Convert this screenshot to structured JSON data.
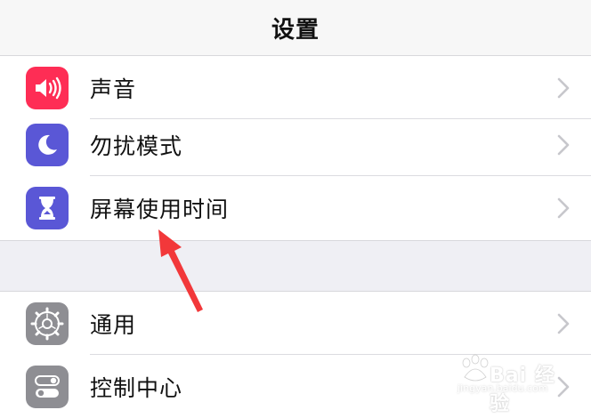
{
  "nav": {
    "title": "设置"
  },
  "group1": {
    "items": [
      {
        "label": "声音",
        "icon": "speaker-icon",
        "color": "#fe2d55"
      },
      {
        "label": "勿扰模式",
        "icon": "moon-icon",
        "color": "#5a57d6"
      },
      {
        "label": "屏幕使用时间",
        "icon": "hourglass-icon",
        "color": "#5a57d6"
      }
    ]
  },
  "group2": {
    "items": [
      {
        "label": "通用",
        "icon": "gear-icon",
        "color": "#8e8e93"
      },
      {
        "label": "控制中心",
        "icon": "toggle-switches-icon",
        "color": "#8e8e93"
      }
    ]
  },
  "annotation": {
    "arrow_color": "#f2383a"
  },
  "watermark": {
    "brand": "Bai 经验",
    "url": "jingyan.baidu.com"
  }
}
